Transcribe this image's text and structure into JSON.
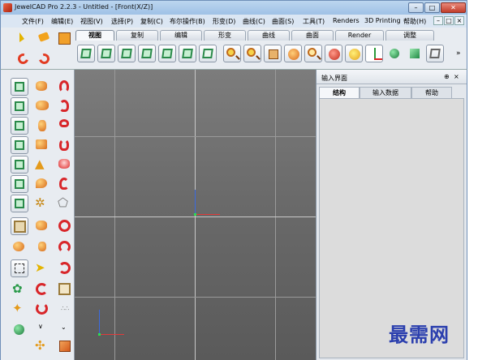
{
  "window": {
    "title": "JewelCAD Pro 2.2.3 - Untitled - [Front(X/Z)]",
    "minimize_glyph": "–",
    "maximize_glyph": "□",
    "close_glyph": "✕"
  },
  "menu": {
    "items": [
      "文件(F)",
      "编辑(E)",
      "视图(V)",
      "选择(P)",
      "复制(C)",
      "布尔操作(B)",
      "形变(D)",
      "曲线(C)",
      "曲面(S)",
      "工具(T)",
      "Renders",
      "3D Printing",
      "帮助(H)"
    ],
    "mdi_glyphs": [
      "–",
      "□",
      "×"
    ]
  },
  "toolbar": {
    "tabs": [
      "视图",
      "复制",
      "编辑",
      "形变",
      "曲线",
      "曲面",
      "Render",
      "调整"
    ],
    "active_tab": "视图",
    "more_glyph": "»",
    "icons": [
      "front-view-icon",
      "back-view-icon",
      "top-view-icon",
      "bottom-view-icon",
      "left-view-icon",
      "right-view-icon",
      "perspective-view-icon",
      "zoom-in-icon",
      "zoom-out-icon",
      "zoom-fit-icon",
      "rotate-view-icon",
      "zoom-window-icon",
      "render-preview-icon",
      "light-icon",
      "axes-icon",
      "sphere-shading-icon",
      "solid-cube-icon",
      "wireframe-cube-icon"
    ]
  },
  "left_tools": {
    "icons": [
      "cube-view-icon",
      "capsule-icon",
      "curve-red-icon",
      "cube-front-icon",
      "pill-icon",
      "hand-curve-icon",
      "cube-side-icon",
      "cylinder-icon",
      "twist-icon",
      "cube-top-icon",
      "deform-icon",
      "spiral-icon",
      "cube-bottom-icon",
      "pyramid-icon",
      "flame-icon",
      "cube-right-icon",
      "drop-icon",
      "hook-icon",
      "cube-left-icon",
      "gear-icon",
      "gem-outline-icon",
      "grid-icon",
      "twin-ball-icon",
      "ring-icon",
      "align-icon",
      "bead-icon",
      "ring-shank-icon",
      "select-box-icon",
      "pointer-icon",
      "ring-open-icon",
      "flower-icon",
      "rotate-left-icon",
      "loop-icon",
      "star-icon",
      "rotate-right-icon",
      "pattern-icon",
      "ball-icon",
      "more-icon",
      "expand-icon",
      "cross-icon",
      "tile-icon"
    ]
  },
  "panel": {
    "title": "输入界面",
    "pin_glyph": "⊕",
    "close_glyph": "×",
    "tabs": [
      "结构",
      "输入数据",
      "帮助"
    ],
    "active_tab": "结构"
  },
  "watermark": "最需网",
  "colors": {
    "viewport_bg": "#6e6e6e",
    "accent": "#2a8a4a",
    "x_axis": "#e03a3a",
    "y_axis": "#3a6ae0"
  }
}
